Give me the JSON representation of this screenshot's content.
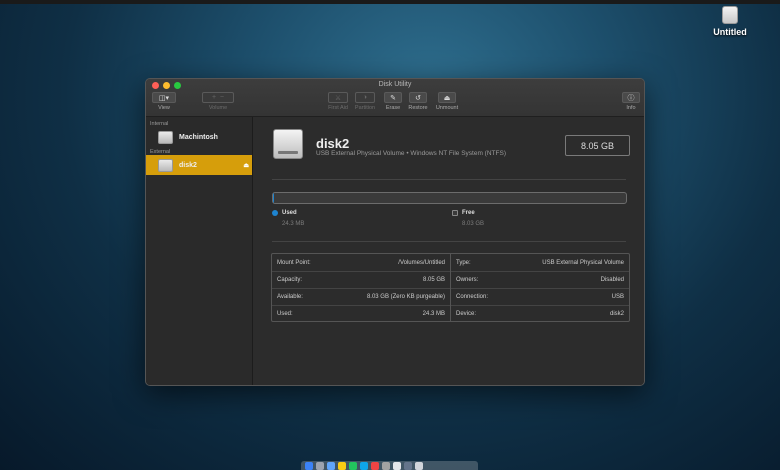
{
  "desktop": {
    "drive_label": "Untitled"
  },
  "window": {
    "title": "Disk Utility",
    "toolbar": {
      "view": "View",
      "volume": "Volume",
      "first_aid": "First Aid",
      "partition": "Partition",
      "erase": "Erase",
      "restore": "Restore",
      "unmount": "Unmount",
      "info": "Info"
    }
  },
  "sidebar": {
    "internal_header": "Internal",
    "internal_item": "Machintosh",
    "external_header": "External",
    "external_item": "disk2"
  },
  "disk": {
    "name": "disk2",
    "description": "USB External Physical Volume • Windows NT File System (NTFS)",
    "size": "8.05 GB",
    "used_fraction": 0.003
  },
  "legend": {
    "used_label": "Used",
    "used_value": "24.3 MB",
    "free_label": "Free",
    "free_value": "8.03 GB"
  },
  "details": {
    "left": [
      {
        "label": "Mount Point:",
        "value": "/Volumes/Untitled"
      },
      {
        "label": "Capacity:",
        "value": "8.05 GB"
      },
      {
        "label": "Available:",
        "value": "8.03 GB (Zero KB purgeable)"
      },
      {
        "label": "Used:",
        "value": "24.3 MB"
      }
    ],
    "right": [
      {
        "label": "Type:",
        "value": "USB External Physical Volume"
      },
      {
        "label": "Owners:",
        "value": "Disabled"
      },
      {
        "label": "Connection:",
        "value": "USB"
      },
      {
        "label": "Device:",
        "value": "disk2"
      }
    ]
  },
  "colors": {
    "accent_selection": "#d69e0b",
    "used_blue": "#1e84d0",
    "close": "#ff5f57",
    "minimize": "#febc2e",
    "zoom": "#28c840"
  }
}
